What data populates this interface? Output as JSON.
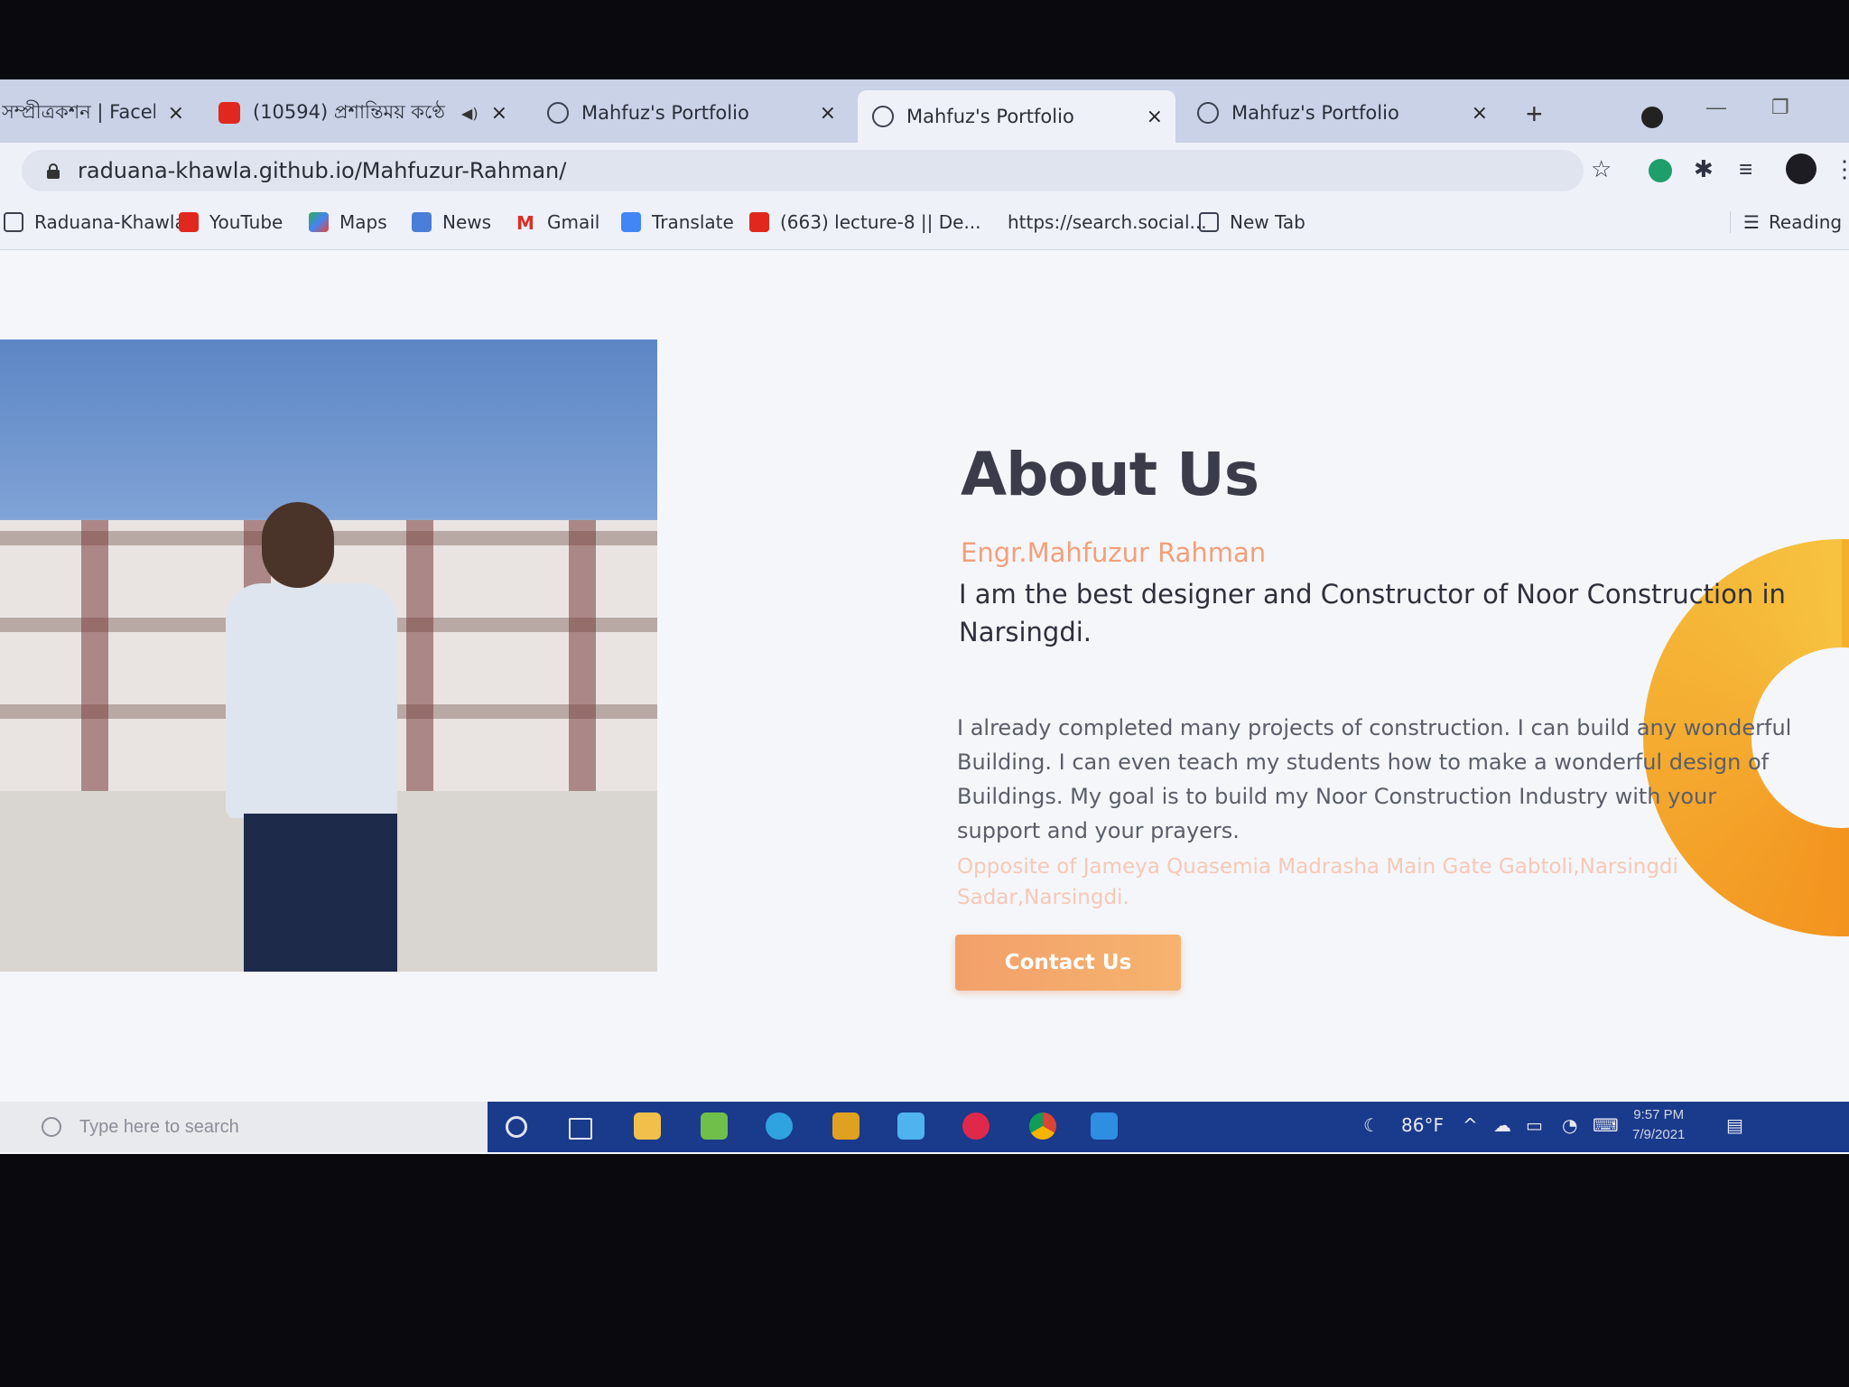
{
  "browser": {
    "tabs": [
      {
        "label": "সম্প্রীত্রকশন | Facebook",
        "favicon": "facebook-icon",
        "active": false
      },
      {
        "label": "(10594) প্রশান্তিময় কণ্ঠে",
        "favicon": "youtube-icon",
        "active": false
      },
      {
        "label": "Mahfuz's Portfolio",
        "favicon": "globe-icon",
        "active": false
      },
      {
        "label": "Mahfuz's Portfolio",
        "favicon": "globe-icon",
        "active": true
      },
      {
        "label": "Mahfuz's Portfolio",
        "favicon": "globe-icon",
        "active": false
      }
    ],
    "tab_close_glyph": "×",
    "new_tab_glyph": "+",
    "url": "raduana-khawla.github.io/Mahfuzur-Rahman/",
    "bookmarks": [
      {
        "label": "Raduana-Khawla",
        "icon": "globe-icon"
      },
      {
        "label": "YouTube",
        "icon": "youtube-icon"
      },
      {
        "label": "Maps",
        "icon": "maps-icon"
      },
      {
        "label": "News",
        "icon": "news-icon"
      },
      {
        "label": "Gmail",
        "icon": "gmail-icon"
      },
      {
        "label": "Translate",
        "icon": "translate-icon"
      },
      {
        "label": "(663) lecture-8 || De...",
        "icon": "youtube-icon"
      },
      {
        "label": "https://search.social...",
        "icon": "none"
      },
      {
        "label": "New Tab",
        "icon": "globe-icon"
      }
    ],
    "reading_list": "Reading list"
  },
  "page": {
    "title": "About Us",
    "name": "Engr.Mahfuzur Rahman",
    "tagline": "I am the best designer and Constructor of Noor Construction in Narsingdi.",
    "bio": "I already completed many projects of construction. I can build any wonderful Building. I can even teach my students how to make a wonderful design of Buildings. My goal is to build my Noor Construction Industry with your support and your prayers.",
    "address": "Opposite of Jameya Quasemia Madrasha Main Gate Gabtoli,Narsingdi Sadar,Narsingdi.",
    "contact_button": "Contact Us"
  },
  "taskbar": {
    "search_placeholder": "Type here to search",
    "weather": "86°F",
    "time": "9:57 PM",
    "date": "7/9/2021"
  },
  "colors": {
    "accent_orange": "#f2a07a",
    "button_gradient_start": "#f2a06a",
    "donut_yellow": "#f5b02b",
    "taskbar": "#1a3a8c"
  }
}
